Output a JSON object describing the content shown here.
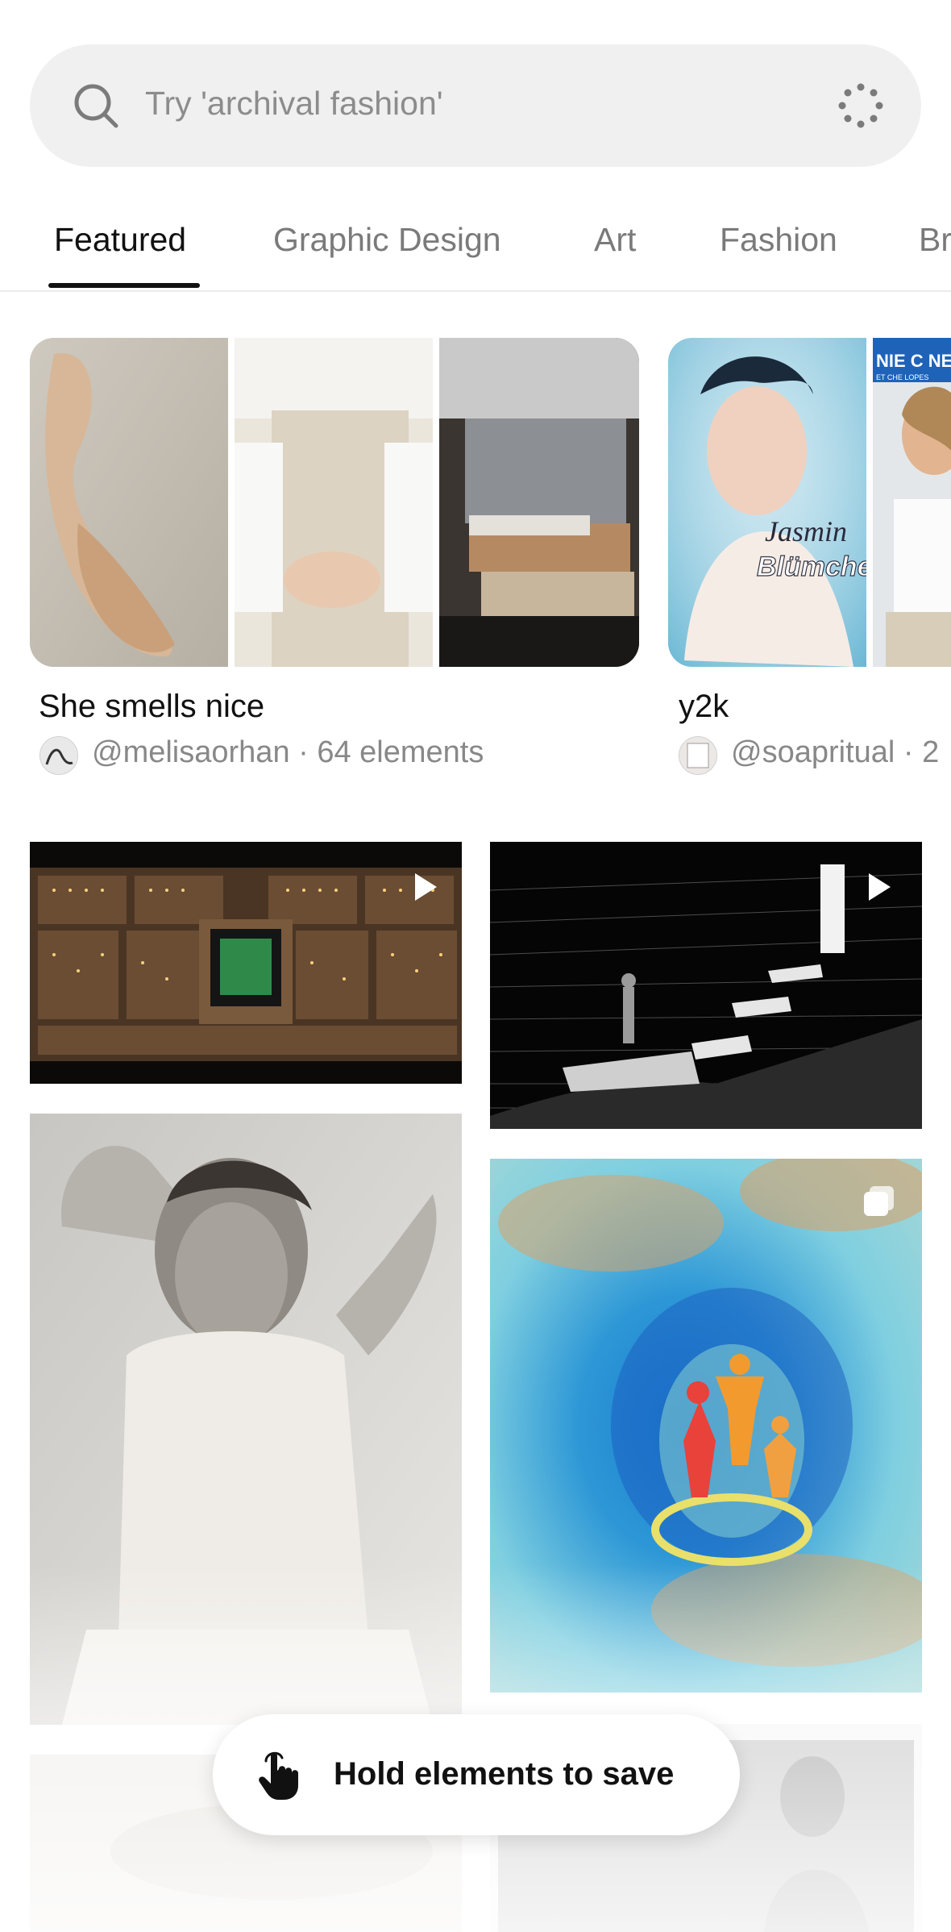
{
  "search": {
    "placeholder": "Try 'archival fashion'",
    "icon": "search-icon",
    "loading_icon": "loading-spinner-icon"
  },
  "tabs": [
    {
      "label": "Featured",
      "active": true
    },
    {
      "label": "Graphic Design",
      "active": false
    },
    {
      "label": "Art",
      "active": false
    },
    {
      "label": "Fashion",
      "active": false
    },
    {
      "label": "Br",
      "active": false
    }
  ],
  "collections": [
    {
      "title": "She smells nice",
      "handle": "@melisaorhan",
      "meta": "· 64 elements"
    },
    {
      "title": "y2k",
      "handle": "@soapritual",
      "meta": "· 2"
    }
  ],
  "collection_image_text": {
    "script_name": "Jasmin",
    "logo": "Blümchen",
    "cd_banner": "NIE C NEVE",
    "cd_sub": "ET CHE LOPES"
  },
  "tiles": {
    "video_badge": "play-icon",
    "multi_badge": "carousel-icon"
  },
  "toast": {
    "label": "Hold elements to save",
    "icon": "tap-hand-icon"
  }
}
